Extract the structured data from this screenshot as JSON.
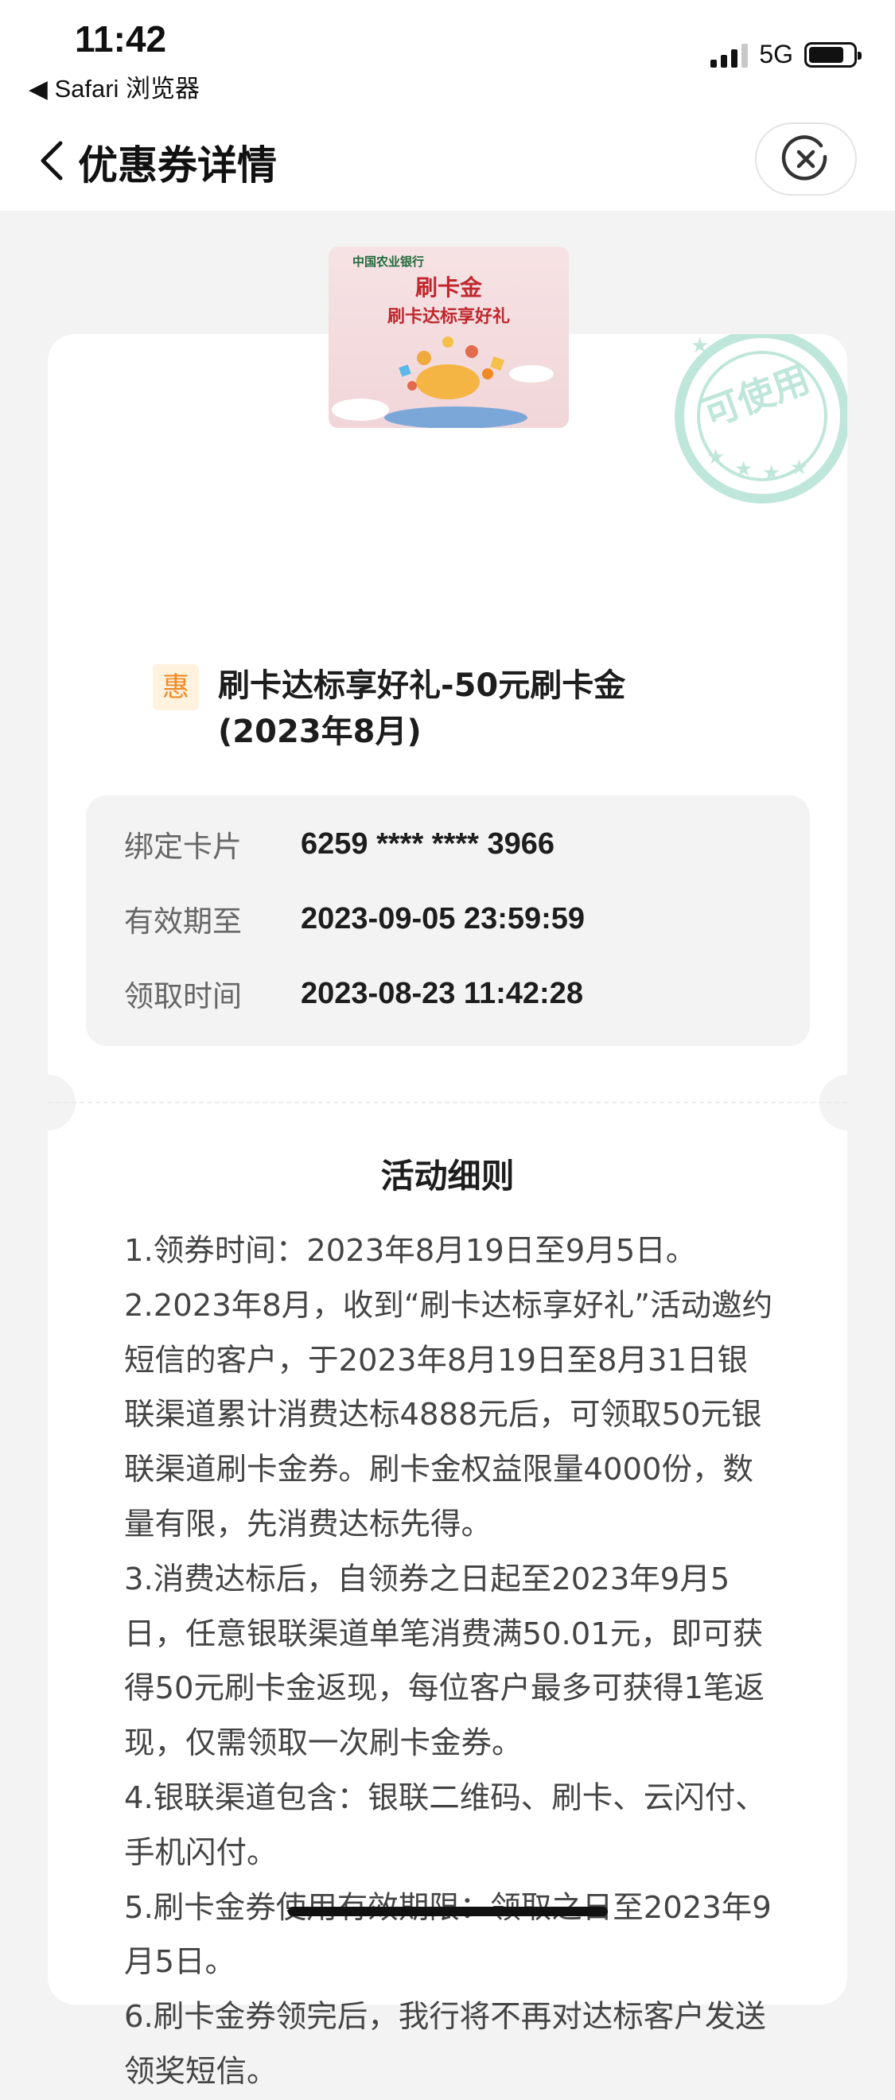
{
  "status_bar": {
    "time": "11:42",
    "back_app": "◀ Safari 浏览器",
    "network": "5G",
    "signal_bars": 4,
    "signal_active": 3,
    "battery_level": 0.8
  },
  "nav": {
    "title": "优惠券详情",
    "back_icon": "chevron-left-icon",
    "close_icon": "close-circle-icon"
  },
  "coupon": {
    "image": {
      "bank_name": "中国农业银行",
      "title": "刷卡金",
      "subtitle": "刷卡达标享好礼"
    },
    "stamp_text": "可使用",
    "tag": "惠",
    "title": "刷卡达标享好礼-50元刷卡金(2023年8月)",
    "details": [
      {
        "label": "绑定卡片",
        "value": "6259 **** **** 3966"
      },
      {
        "label": "有效期至",
        "value": "2023-09-05 23:59:59"
      },
      {
        "label": "领取时间",
        "value": "2023-08-23 11:42:28"
      }
    ]
  },
  "rules": {
    "title": "活动细则",
    "items": [
      "1.领券时间：2023年8月19日至9月5日。",
      "2.2023年8月，收到“刷卡达标享好礼”活动邀约短信的客户，于2023年8月19日至8月31日银联渠道累计消费达标4888元后，可领取50元银联渠道刷卡金券。刷卡金权益限量4000份，数量有限，先消费达标先得。",
      "3.消费达标后，自领券之日起至2023年9月5日，任意银联渠道单笔消费满50.01元，即可获得50元刷卡金返现，每位客户最多可获得1笔返现，仅需领取一次刷卡金券。",
      "4.银联渠道包含：银联二维码、刷卡、云闪付、手机闪付。",
      "5.刷卡金券使用有效期限：领取之日至2023年9月5日。",
      "6.刷卡金券领完后，我行将不再对达标客户发送领奖短信。"
    ]
  },
  "colors": {
    "accent_orange": "#f08a24",
    "stamp_green": "#bfe6da",
    "bank_green": "#1f6a3a",
    "coupon_red": "#c0282e"
  }
}
